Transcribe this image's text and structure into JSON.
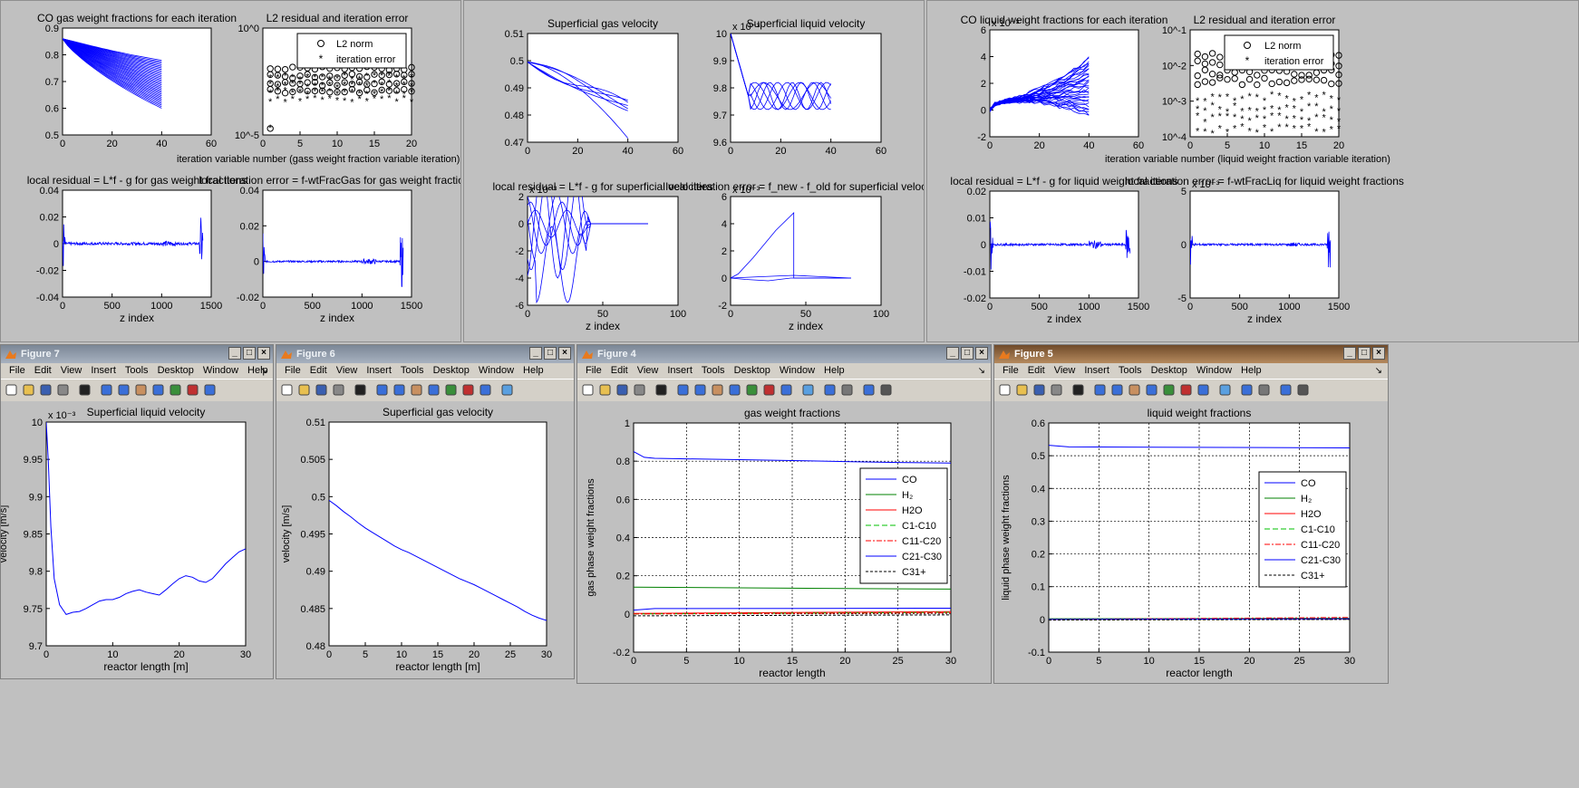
{
  "panels": {
    "gas": {
      "p1_title": "CO gas weight fractions for each iteration",
      "p2_title": "L2 residual and iteration error",
      "p2_xlabel": "iteration variable number (gass weight fraction variable iteration)",
      "p3_title": "local residual = L*f - g for gas weight fractions",
      "p4_title": "local iteration error = f-wtFracGas for gas weight fractions",
      "zlabel": "z index",
      "legend_l2": "L2 norm",
      "legend_iter": "iteration error"
    },
    "vel": {
      "p1_title": "Superficial gas velocity",
      "p2_title": "Superficial liquid velocity",
      "p3_title": "local residual = L*f - g for superficial velocities",
      "p4_title": "local iteration error = f_new - f_old for superficial velocities",
      "zlabel": "z index"
    },
    "liq": {
      "p1_title": "CO liquid weight fractions for each iteration",
      "p2_title": "L2 residual and iteration error",
      "p2_xlabel": "iteration variable number (liquid weight fraction variable iteration)",
      "p3_title": "local residual = L*f - g for liquid weight fractions",
      "p4_title": "local iteration error = f-wtFracLiq for liquid weight fractions",
      "zlabel": "z index",
      "legend_l2": "L2 norm",
      "legend_iter": "iteration error"
    }
  },
  "windows": {
    "fig7": {
      "title": "Figure 7"
    },
    "fig6": {
      "title": "Figure 6"
    },
    "fig4": {
      "title": "Figure 4"
    },
    "fig5": {
      "title": "Figure 5"
    }
  },
  "menu": [
    "File",
    "Edit",
    "View",
    "Insert",
    "Tools",
    "Desktop",
    "Window",
    "Help"
  ],
  "colors": {
    "line_blue": "#0000ff",
    "line_green": "#008000",
    "line_red": "#ff0000",
    "active_title": "#8b5a2b"
  },
  "chart_data": [
    {
      "id": "fig7",
      "type": "line",
      "title": "Superficial liquid velocity",
      "xlabel": "reactor length [m]",
      "ylabel": "velocity [m/s]",
      "xlim": [
        0,
        30
      ],
      "ylim": [
        9.7,
        10
      ],
      "y_multiplier": "x 10^-3",
      "xticks": [
        0,
        10,
        20,
        30
      ],
      "yticks": [
        9.7,
        9.75,
        9.8,
        9.85,
        9.9,
        9.95,
        10
      ],
      "series": [
        {
          "x": [
            0,
            0.3,
            0.7,
            1.2,
            2,
            3,
            4,
            5,
            6,
            7,
            8,
            9,
            10,
            11,
            12,
            13,
            14,
            15,
            16,
            17,
            18,
            19,
            20,
            21,
            22,
            23,
            24,
            25,
            26,
            27,
            28,
            29,
            30
          ],
          "values": [
            10.0,
            9.95,
            9.86,
            9.79,
            9.755,
            9.742,
            9.745,
            9.746,
            9.75,
            9.755,
            9.76,
            9.762,
            9.762,
            9.765,
            9.77,
            9.773,
            9.775,
            9.772,
            9.77,
            9.768,
            9.775,
            9.783,
            9.79,
            9.794,
            9.792,
            9.787,
            9.785,
            9.79,
            9.8,
            9.81,
            9.818,
            9.826,
            9.83
          ]
        }
      ]
    },
    {
      "id": "fig6",
      "type": "line",
      "title": "Superficial gas velocity",
      "xlabel": "reactor length [m]",
      "ylabel": "velocity [m/s]",
      "xlim": [
        0,
        30
      ],
      "ylim": [
        0.48,
        0.51
      ],
      "xticks": [
        0,
        5,
        10,
        15,
        20,
        25,
        30
      ],
      "yticks": [
        0.48,
        0.485,
        0.49,
        0.495,
        0.5,
        0.505,
        0.51
      ],
      "series": [
        {
          "x": [
            0,
            1,
            2,
            3,
            4,
            5,
            6,
            7,
            8,
            9,
            10,
            11,
            12,
            13,
            14,
            15,
            16,
            17,
            18,
            19,
            20,
            21,
            22,
            23,
            24,
            25,
            26,
            27,
            28,
            29,
            30
          ],
          "values": [
            0.4995,
            0.4988,
            0.498,
            0.4973,
            0.4965,
            0.4958,
            0.4952,
            0.4946,
            0.494,
            0.4934,
            0.4929,
            0.4925,
            0.492,
            0.4915,
            0.491,
            0.4905,
            0.49,
            0.4895,
            0.489,
            0.4886,
            0.4882,
            0.4877,
            0.4872,
            0.4867,
            0.4862,
            0.4857,
            0.4852,
            0.4846,
            0.4841,
            0.4837,
            0.4834
          ]
        }
      ]
    },
    {
      "id": "fig4",
      "type": "line",
      "title": "gas weight fractions",
      "xlabel": "reactor length",
      "ylabel": "gas phase weight fractions",
      "xlim": [
        0,
        30
      ],
      "ylim": [
        -0.2,
        1
      ],
      "grid": true,
      "legend": "right",
      "xticks": [
        0,
        5,
        10,
        15,
        20,
        25,
        30
      ],
      "yticks": [
        -0.2,
        0,
        0.2,
        0.4,
        0.6,
        0.8,
        1
      ],
      "series": [
        {
          "name": "CO",
          "x": [
            0,
            1,
            2,
            5,
            10,
            15,
            20,
            25,
            30
          ],
          "values": [
            0.85,
            0.82,
            0.815,
            0.812,
            0.808,
            0.803,
            0.798,
            0.793,
            0.79
          ],
          "color": "#0000ff",
          "dash": ""
        },
        {
          "name": "H2",
          "x": [
            0,
            30
          ],
          "values": [
            0.14,
            0.13
          ],
          "color": "#008000",
          "dash": ""
        },
        {
          "name": "H2O",
          "x": [
            0,
            30
          ],
          "values": [
            0.003,
            0.012
          ],
          "color": "#ff0000",
          "dash": ""
        },
        {
          "name": "C1-C10",
          "x": [
            0,
            30
          ],
          "values": [
            0.0,
            0.008
          ],
          "color": "#00c000",
          "dash": "6,3"
        },
        {
          "name": "C11-C20",
          "x": [
            0,
            30
          ],
          "values": [
            0.0,
            0.006
          ],
          "color": "#ff0000",
          "dash": "6,2,2,2"
        },
        {
          "name": "C21-C30",
          "x": [
            0,
            2,
            30
          ],
          "values": [
            0.02,
            0.028,
            0.03
          ],
          "color": "#0000ff",
          "dash": ""
        },
        {
          "name": "C31+",
          "x": [
            0,
            30
          ],
          "values": [
            -0.01,
            -0.005
          ],
          "color": "#000000",
          "dash": "3,2"
        }
      ]
    },
    {
      "id": "fig5",
      "type": "line",
      "title": "liquid weight fractions",
      "xlabel": "reactor length",
      "ylabel": "liquid phase weight fractions",
      "xlim": [
        0,
        30
      ],
      "ylim": [
        -0.1,
        0.6
      ],
      "grid": true,
      "legend": "right",
      "xticks": [
        0,
        5,
        10,
        15,
        20,
        25,
        30
      ],
      "yticks": [
        -0.1,
        0,
        0.1,
        0.2,
        0.3,
        0.4,
        0.5,
        0.6
      ],
      "series": [
        {
          "name": "CO",
          "x": [
            0,
            2,
            30
          ],
          "values": [
            0.532,
            0.527,
            0.524
          ],
          "color": "#0000ff",
          "dash": ""
        },
        {
          "name": "H2",
          "x": [
            0,
            30
          ],
          "values": [
            0.002,
            0.003
          ],
          "color": "#008000",
          "dash": ""
        },
        {
          "name": "H2O",
          "x": [
            0,
            30
          ],
          "values": [
            0.0,
            0.002
          ],
          "color": "#ff0000",
          "dash": ""
        },
        {
          "name": "C1-C10",
          "x": [
            0,
            30
          ],
          "values": [
            0.0,
            0.004
          ],
          "color": "#00c000",
          "dash": "6,3"
        },
        {
          "name": "C11-C20",
          "x": [
            0,
            30
          ],
          "values": [
            0.0,
            0.006
          ],
          "color": "#ff0000",
          "dash": "6,2,2,2"
        },
        {
          "name": "C21-C30",
          "x": [
            0,
            30
          ],
          "values": [
            0.0,
            0.002
          ],
          "color": "#0000ff",
          "dash": ""
        },
        {
          "name": "C31+",
          "x": [
            0,
            30
          ],
          "values": [
            -0.002,
            0.0
          ],
          "color": "#000000",
          "dash": "3,2"
        }
      ]
    }
  ]
}
